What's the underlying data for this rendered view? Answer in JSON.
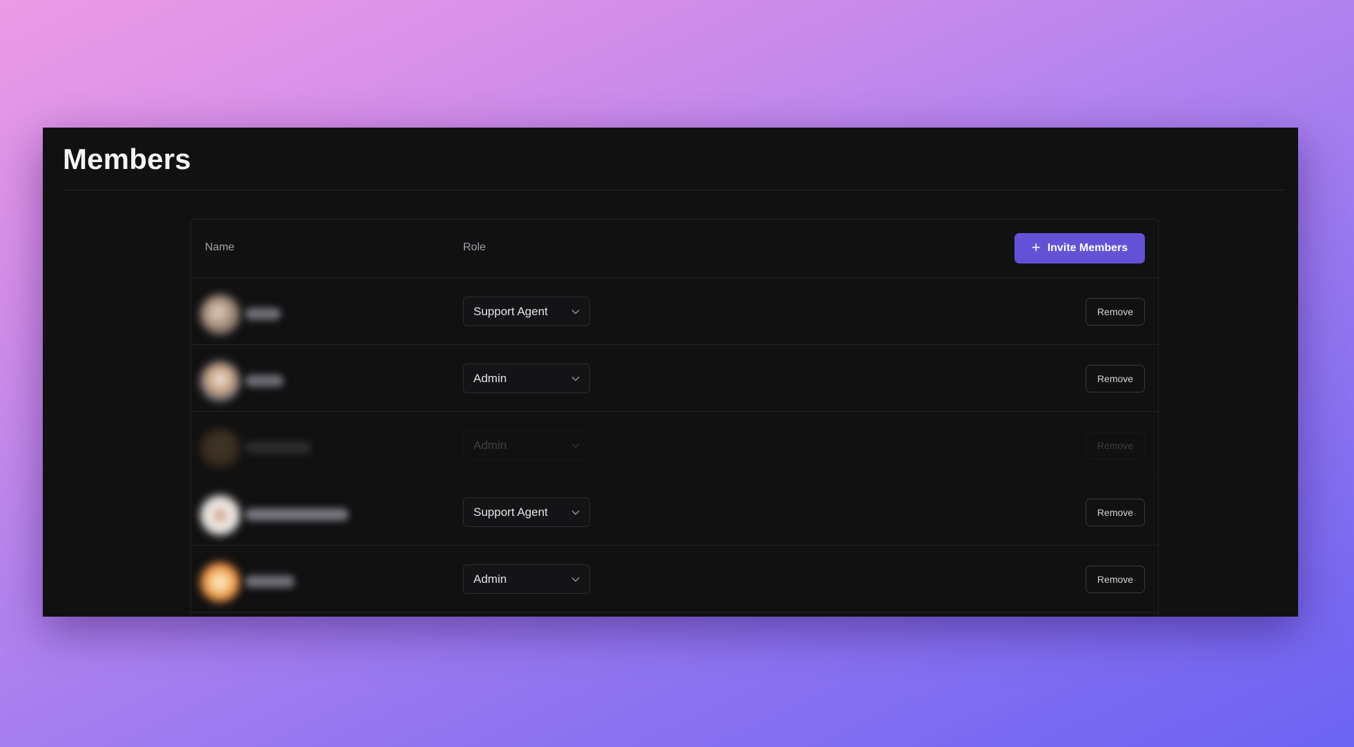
{
  "page": {
    "title": "Members"
  },
  "table": {
    "columns": {
      "name": "Name",
      "role": "Role"
    },
    "invite_label": "Invite Members",
    "invite_icon": "plus-icon",
    "accent_color": "#6352d6",
    "rows": [
      {
        "role": "Support Agent",
        "remove_label": "Remove",
        "pending": false
      },
      {
        "role": "Admin",
        "remove_label": "Remove",
        "pending": false
      },
      {
        "role": "Admin",
        "remove_label": "Remove",
        "pending": true
      },
      {
        "role": "Support Agent",
        "remove_label": "Remove",
        "pending": false
      },
      {
        "role": "Admin",
        "remove_label": "Remove",
        "pending": false
      }
    ]
  }
}
